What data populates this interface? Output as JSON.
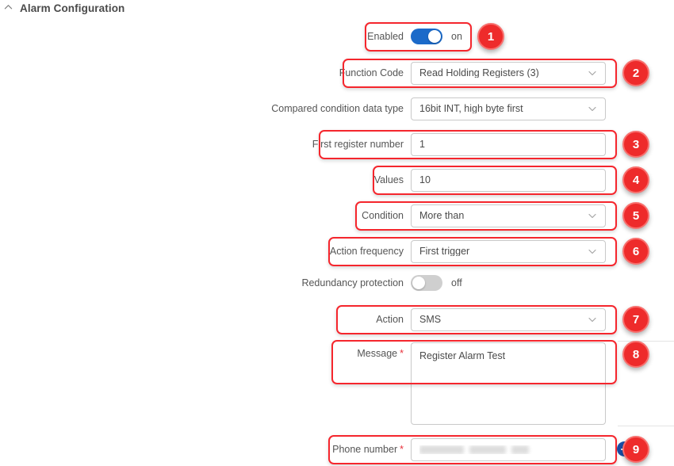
{
  "header": {
    "title": "Alarm Configuration",
    "collapse_icon": "chevron-up-icon"
  },
  "form": {
    "rows": [
      {
        "key": "enabled",
        "label": "Enabled",
        "type": "toggle",
        "state": "on",
        "state_label": "on",
        "required": false
      },
      {
        "key": "function_code",
        "label": "Function Code",
        "type": "select",
        "value": "Read Holding Registers (3)",
        "required": false
      },
      {
        "key": "compared_condition_data_type",
        "label": "Compared condition data type",
        "type": "select",
        "value": "16bit INT, high byte first",
        "required": false
      },
      {
        "key": "first_register_number",
        "label": "First register number",
        "type": "text",
        "value": "1",
        "required": false
      },
      {
        "key": "values",
        "label": "Values",
        "type": "text",
        "value": "10",
        "required": false
      },
      {
        "key": "condition",
        "label": "Condition",
        "type": "select",
        "value": "More than",
        "required": false
      },
      {
        "key": "action_frequency",
        "label": "Action frequency",
        "type": "select",
        "value": "First trigger",
        "required": false
      },
      {
        "key": "redundancy_protection",
        "label": "Redundancy protection",
        "type": "toggle",
        "state": "off",
        "state_label": "off",
        "required": false
      },
      {
        "key": "action",
        "label": "Action",
        "type": "select",
        "value": "SMS",
        "required": false
      },
      {
        "key": "message",
        "label": "Message",
        "type": "textarea",
        "value": "Register Alarm Test",
        "required": true,
        "required_marker": "*"
      },
      {
        "key": "phone_number",
        "label": "Phone number",
        "type": "text",
        "value": "",
        "value_redacted": true,
        "required": true,
        "required_marker": "*"
      }
    ]
  },
  "annotations": {
    "badges": [
      {
        "number": "1",
        "target": "enabled"
      },
      {
        "number": "2",
        "target": "function_code"
      },
      {
        "number": "3",
        "target": "first_register_number"
      },
      {
        "number": "4",
        "target": "values"
      },
      {
        "number": "5",
        "target": "condition"
      },
      {
        "number": "6",
        "target": "action_frequency"
      },
      {
        "number": "7",
        "target": "action"
      },
      {
        "number": "8",
        "target": "message"
      },
      {
        "number": "9",
        "target": "phone_number"
      }
    ]
  },
  "colors": {
    "annotation_red": "#ee2b2b",
    "annotation_box_red": "#f5262d",
    "toggle_on_blue": "#1b6ac9",
    "toggle_off_gray": "#cfcfcf",
    "remove_button_blue": "#1b4fa8",
    "required_asterisk": "#e8323c",
    "field_border": "#c9c9c9",
    "separator": "#e4e4e4",
    "text": "#555555"
  }
}
